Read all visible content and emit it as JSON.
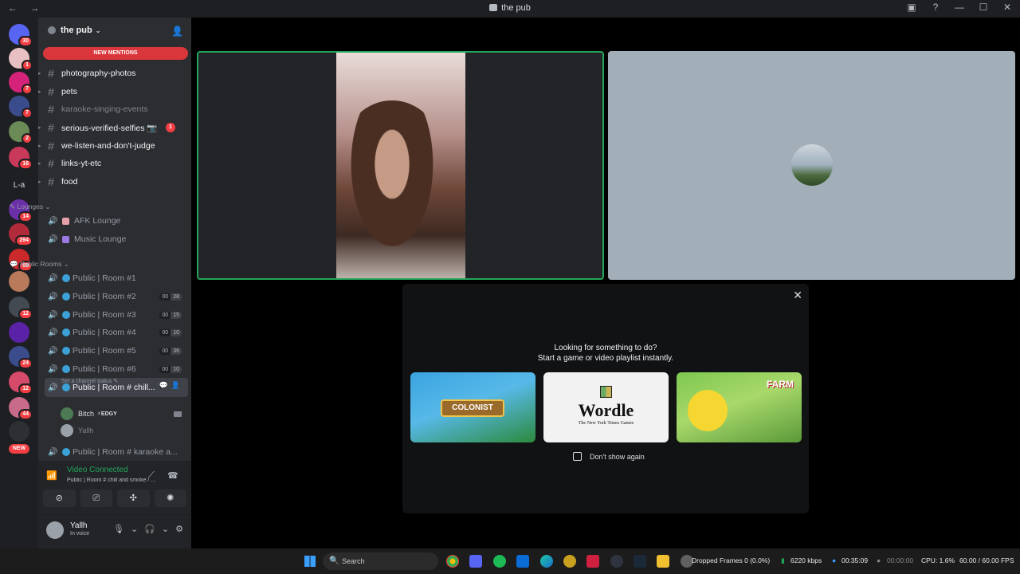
{
  "window": {
    "title": "the pub",
    "nav": "← →",
    "controls": [
      "inbox-icon",
      "help-icon",
      "minimize-icon",
      "maximize-icon",
      "close-icon"
    ]
  },
  "rail": {
    "servers": [
      {
        "name": "direct-messages",
        "badge": "30",
        "color": "#5865f2"
      },
      {
        "name": "server-1",
        "badge": "1",
        "color": "#e8c0c4"
      },
      {
        "name": "server-2",
        "badge": "7",
        "color": "#d6237a"
      },
      {
        "name": "server-3",
        "badge": "7",
        "color": "#3b4c8c"
      },
      {
        "name": "server-4",
        "badge": "2",
        "color": "#6a8a56"
      },
      {
        "name": "server-5",
        "badge": "16",
        "color": "#c8395a"
      },
      {
        "name": "server-text",
        "label": "L-a"
      },
      {
        "name": "server-6",
        "badge": "14",
        "color": "#6b2fa8"
      },
      {
        "name": "server-7",
        "badge": "294",
        "color": "#b22b3a"
      },
      {
        "name": "server-8",
        "badge": "59",
        "color": "#cc2a2a"
      },
      {
        "name": "server-9",
        "badge": "",
        "color": "#b87a5a"
      },
      {
        "name": "server-10",
        "badge": "12",
        "color": "#444a52"
      },
      {
        "name": "server-11",
        "badge": "",
        "color": "#5a22a6"
      },
      {
        "name": "server-12",
        "badge": "24",
        "color": "#3b4c8c"
      },
      {
        "name": "server-13",
        "badge": "12",
        "color": "#d64a6a"
      },
      {
        "name": "server-14",
        "badge": "44",
        "color": "#c86a8a"
      },
      {
        "name": "server-15",
        "badge": "",
        "color": "#2e2f33"
      }
    ],
    "new_label": "NEW"
  },
  "guild": {
    "name": "the pub",
    "new_mentions": "NEW MENTIONS"
  },
  "text_channels": [
    {
      "name": "photography-photos",
      "muted": false
    },
    {
      "name": "pets",
      "muted": false
    },
    {
      "name": "karaoke-singing-events",
      "muted": true
    },
    {
      "name": "serious-verified-selfies 📷",
      "muted": false,
      "unread": "1"
    },
    {
      "name": "we-listen-and-don't-judge",
      "muted": false
    },
    {
      "name": "links-yt-etc",
      "muted": false
    },
    {
      "name": "food",
      "muted": false
    }
  ],
  "lounges_category": "Lounges",
  "lounges": [
    {
      "name": "AFK Lounge",
      "color": "#e8a0a8"
    },
    {
      "name": "Music Lounge",
      "color": "#9a7ae0"
    }
  ],
  "public_category": "Public Rooms",
  "public_rooms": [
    {
      "name": "Public | Room #1",
      "cnt": null
    },
    {
      "name": "Public | Room #2",
      "cnt": [
        "00",
        "28"
      ]
    },
    {
      "name": "Public | Room #3",
      "cnt": [
        "00",
        "15"
      ]
    },
    {
      "name": "Public | Room #4",
      "cnt": [
        "00",
        "10"
      ]
    },
    {
      "name": "Public | Room #5",
      "cnt": [
        "00",
        "36"
      ]
    },
    {
      "name": "Public | Room #6",
      "cnt": [
        "00",
        "10"
      ]
    }
  ],
  "active_room": {
    "name": "Public | Room # chill...",
    "status": "Set a channel status ✎"
  },
  "voice_users": [
    {
      "name": "Bitch",
      "tag": "⚡EDGY"
    },
    {
      "name": "Yallh",
      "tag": ""
    }
  ],
  "karaoke_room": "Public | Room # karaoke a...",
  "voice_panel": {
    "title": "Video Connected",
    "subtitle": "Public | Room # chill and smoke / ...",
    "buttons": [
      "camera-off-icon",
      "screen-share-icon",
      "activities-icon",
      "soundboard-icon"
    ]
  },
  "user": {
    "name": "Yallh",
    "status": "In voice"
  },
  "activity_modal": {
    "line1": "Looking for something to do?",
    "line2": "Start a game or video playlist instantly.",
    "cards": [
      {
        "name": "colonist",
        "label": "COLONIST"
      },
      {
        "name": "wordle",
        "label": "Wordle",
        "sub": "The New York Times Games"
      },
      {
        "name": "farm-valley",
        "label": "FARM"
      }
    ],
    "dont_show": "Don't show again"
  },
  "taskbar": {
    "search_placeholder": "Search",
    "stats": {
      "dropped": "Dropped Frames 0 (0.0%)",
      "bitrate": "6220 kbps",
      "rec_time": "00:35:09",
      "stream_time": "00:00:00",
      "cpu": "CPU: 1.6%",
      "fps": "60.00 / 60.00 FPS"
    }
  }
}
